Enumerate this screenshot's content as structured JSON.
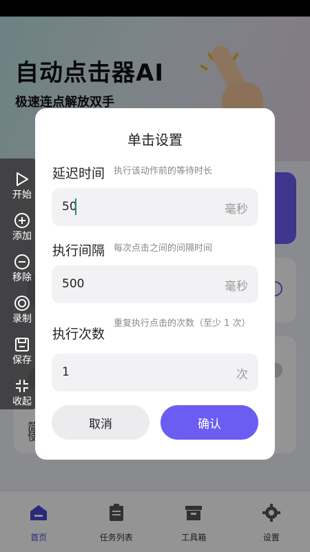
{
  "hero": {
    "title": "自动点击器AI",
    "subtitle": "极速连点解放双手"
  },
  "background_card": {
    "line1": "简",
    "line2": "使"
  },
  "bottom_nav": [
    {
      "label": "首页",
      "icon": "home-icon",
      "active": true
    },
    {
      "label": "任务列表",
      "icon": "clipboard-icon",
      "active": false
    },
    {
      "label": "工具箱",
      "icon": "toolbox-icon",
      "active": false
    },
    {
      "label": "设置",
      "icon": "gear-icon",
      "active": false
    }
  ],
  "side_panel": [
    {
      "label": "开始",
      "icon": "play-icon"
    },
    {
      "label": "添加",
      "icon": "add-circle-icon"
    },
    {
      "label": "移除",
      "icon": "remove-circle-icon"
    },
    {
      "label": "录制",
      "icon": "record-icon"
    },
    {
      "label": "保存",
      "icon": "save-icon"
    },
    {
      "label": "收起",
      "icon": "collapse-icon"
    }
  ],
  "dialog": {
    "title": "单击设置",
    "fields": [
      {
        "label": "延迟时间",
        "hint": "执行该动作前的等待时长",
        "value": "50",
        "unit": "毫秒"
      },
      {
        "label": "执行间隔",
        "hint": "每次点击之间的间隔时间",
        "value": "500",
        "unit": "毫秒"
      },
      {
        "label": "执行次数",
        "hint": "重复执行点击的次数（至少 1 次）",
        "value": "1",
        "unit": "次"
      }
    ],
    "cancel_label": "取消",
    "confirm_label": "确认"
  },
  "colors": {
    "accent": "#6b5cf2",
    "nav_active": "#4a47d6"
  }
}
